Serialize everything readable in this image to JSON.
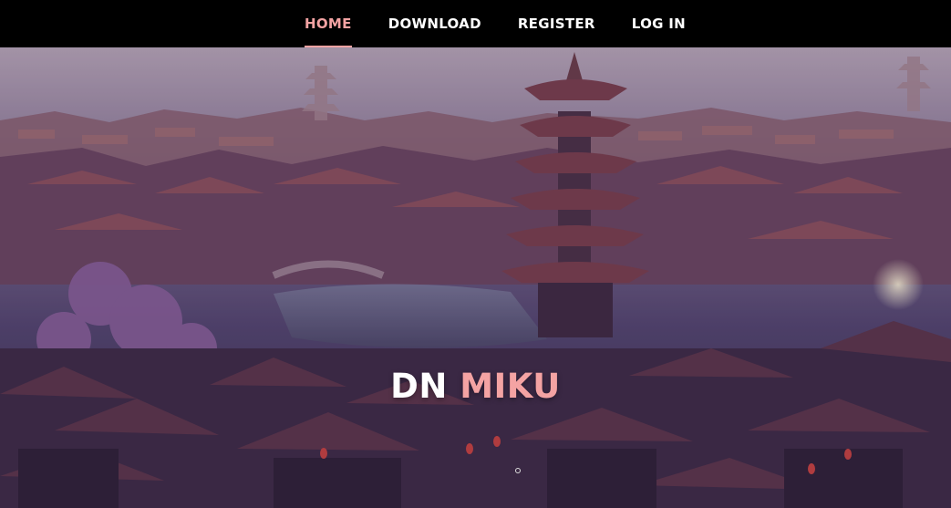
{
  "nav": {
    "items": [
      {
        "label": "HOME",
        "active": true
      },
      {
        "label": "DOWNLOAD",
        "active": false
      },
      {
        "label": "REGISTER",
        "active": false
      },
      {
        "label": "LOG IN",
        "active": false
      }
    ]
  },
  "hero": {
    "title_part1": "DN",
    "title_part2": "MIKU",
    "background_image": "ancient-chinese-town-with-pagoda-illustration"
  },
  "colors": {
    "nav_bg": "#000000",
    "accent": "#f4a3a3",
    "text": "#ffffff"
  }
}
